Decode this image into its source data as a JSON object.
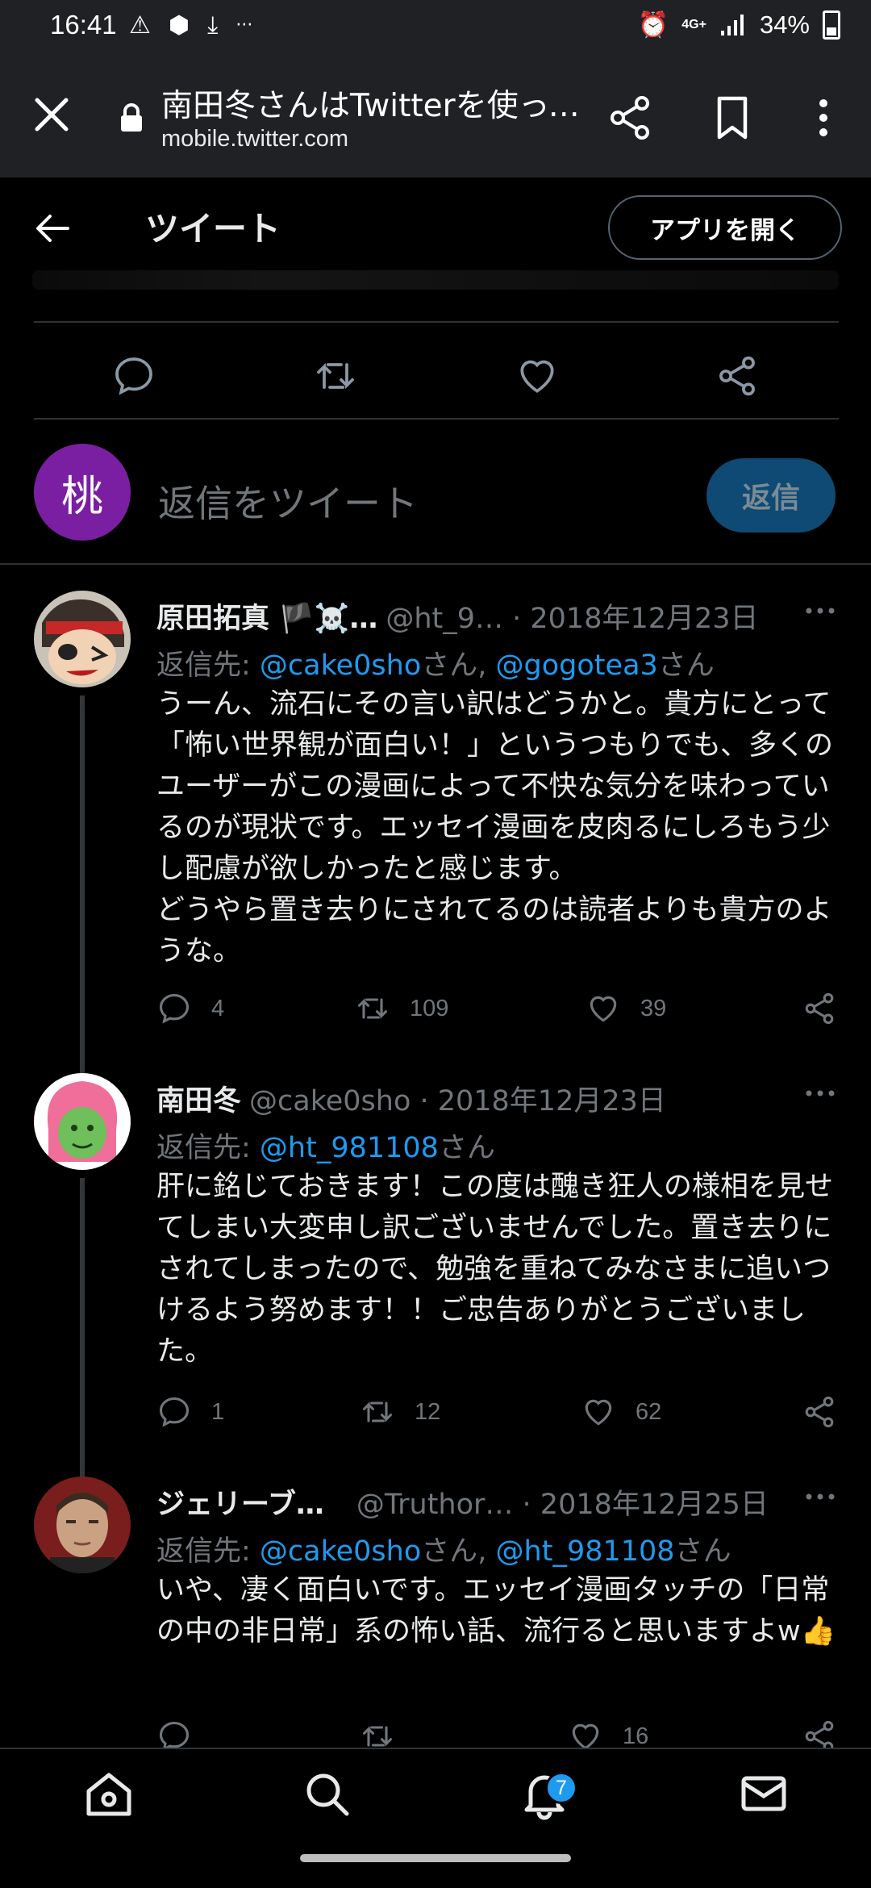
{
  "status_bar": {
    "time": "16:41",
    "dots": "···",
    "network": "4G+",
    "battery": "34%"
  },
  "browser": {
    "title": "南田冬さんはTwitterを使っています",
    "url": "mobile.twitter.com"
  },
  "header": {
    "title": "ツイート",
    "open_app": "アプリを開く"
  },
  "composer": {
    "avatar_char": "桃",
    "placeholder": "返信をツイート",
    "reply_button": "返信"
  },
  "replies": [
    {
      "name": "原田拓真 🏴☠️…",
      "handle": "@ht_9… · 2018年12月23日",
      "reply_prefix": "返信先: ",
      "mention1": "@cake0sho",
      "sep1": "さん, ",
      "mention2": "@gogotea3",
      "sep2": "さん",
      "body": "うーん、流石にその言い訳はどうかと。貴方にとって「怖い世界観が面白い！」というつもりでも、多くのユーザーがこの漫画によって不快な気分を味わっているのが現状です。エッセイ漫画を皮肉るにしろもう少し配慮が欲しかったと感じます。\nどうやら置き去りにされてるのは読者よりも貴方のような。",
      "replies_count": "4",
      "retweets": "109",
      "likes": "39"
    },
    {
      "name": "南田冬",
      "handle": "@cake0sho · 2018年12月23日",
      "reply_prefix": "返信先: ",
      "mention1": "@ht_981108",
      "sep1": "さん",
      "body": "肝に銘じておきます！この度は醜き狂人の様相を見せてしまい大変申し訳ございませんでした。置き去りにされてしまったので、勉強を重ねてみなさまに追いつけるよう努めます！！ご忠告ありがとうございました。",
      "replies_count": "1",
      "retweets": "12",
      "likes": "62"
    },
    {
      "name": "ジェリーブ…",
      "handle": "@Truthor…  · 2018年12月25日",
      "reply_prefix": "返信先: ",
      "mention1": "@cake0sho",
      "sep1": "さん, ",
      "mention2": "@ht_981108",
      "sep2": "さん",
      "body": "いや、凄く面白いです。エッセイ漫画タッチの「日常の中の非日常」系の怖い話、流行ると思いますよw👍",
      "likes": "16"
    }
  ],
  "bottom_nav": {
    "notifications_badge": "7"
  },
  "colors": {
    "accent": "#1d9bf0",
    "muted": "#71767b",
    "background": "#000000",
    "chrome": "#202124"
  }
}
